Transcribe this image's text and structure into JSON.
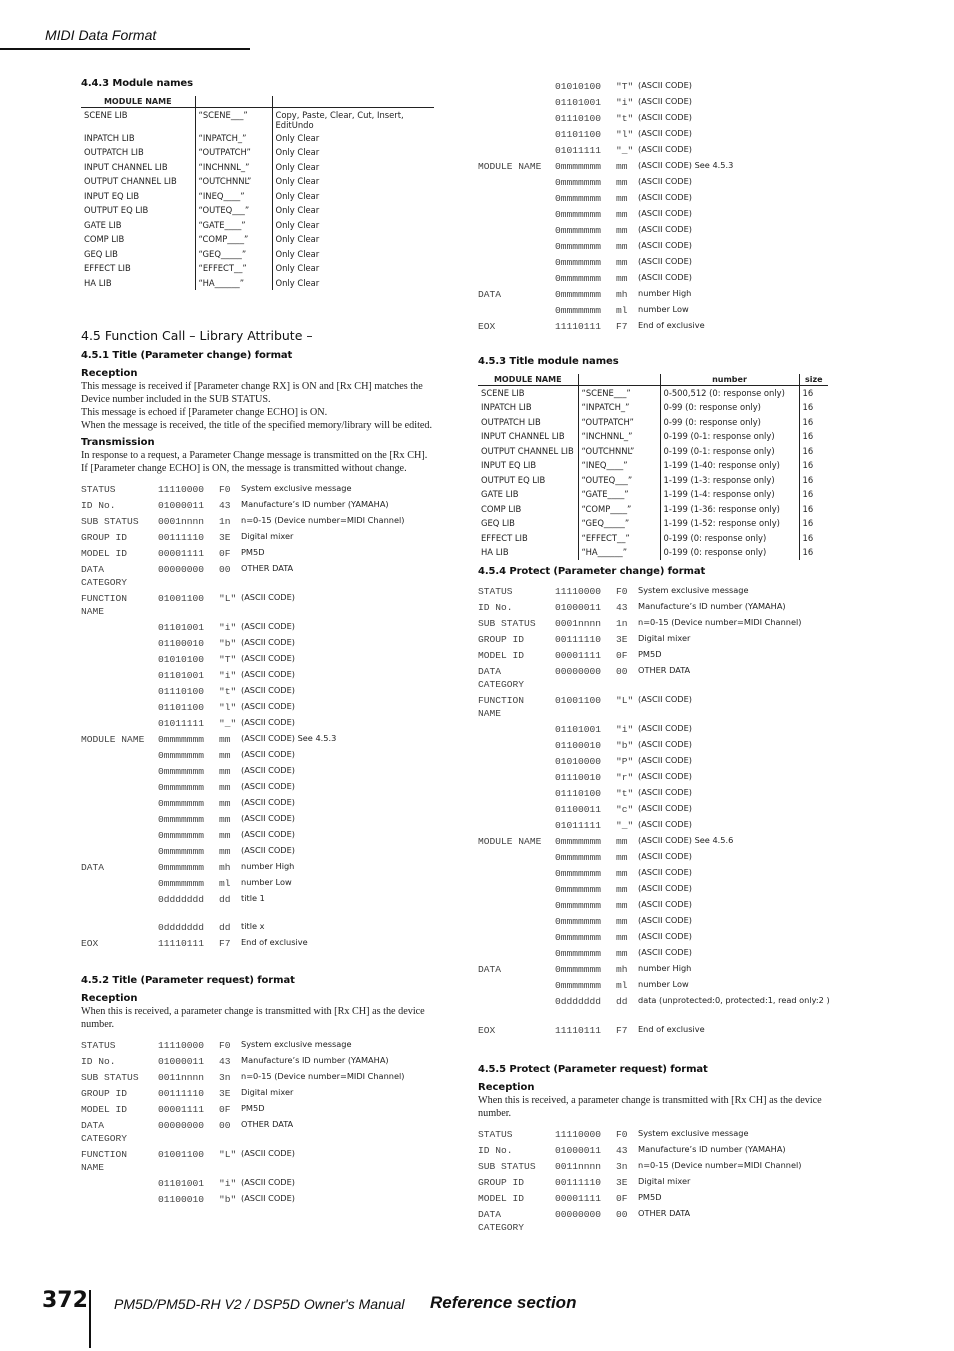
{
  "header": {
    "title": "MIDI Data Format"
  },
  "footer": {
    "page_number": "372",
    "manual_title": "PM5D/PM5D-RH V2 / DSP5D Owner's Manual",
    "section": "Reference section"
  },
  "s443": {
    "heading": "4.4.3 Module names",
    "columns": [
      "MODULE NAME",
      "",
      ""
    ],
    "rows": [
      [
        "SCENE LIB",
        "“SCENE___”",
        "Copy, Paste, Clear, Cut, Insert, EditUndo"
      ],
      [
        "INPATCH LIB",
        "“INPATCH_”",
        "Only Clear"
      ],
      [
        "OUTPATCH LIB",
        "“OUTPATCH”",
        "Only Clear"
      ],
      [
        "INPUT CHANNEL LIB",
        "“INCHNNL_”",
        "Only Clear"
      ],
      [
        "OUTPUT CHANNEL LIB",
        "“OUTCHNNL”",
        "Only Clear"
      ],
      [
        "INPUT EQ LIB",
        "“INEQ____”",
        "Only Clear"
      ],
      [
        "OUTPUT EQ LIB",
        "“OUTEQ___”",
        "Only Clear"
      ],
      [
        "GATE LIB",
        "“GATE____”",
        "Only Clear"
      ],
      [
        "COMP LIB",
        "“COMP____”",
        "Only Clear"
      ],
      [
        "GEQ LIB",
        "“GEQ_____”",
        "Only Clear"
      ],
      [
        "EFFECT LIB",
        "“EFFECT__”",
        "Only Clear"
      ],
      [
        "HA LIB",
        "“HA______”",
        "Only Clear"
      ]
    ]
  },
  "s45": {
    "heading": "4.5  Function Call – Library Attribute –"
  },
  "s451": {
    "heading": "4.5.1 Title (Parameter change) format",
    "reception_heading": "Reception",
    "reception_text": [
      "This message is received if [Parameter change RX] is ON and [Rx CH] matches the Device number included in the SUB STATUS.",
      "This message is echoed if [Parameter change ECHO] is ON.",
      "When the message is received, the title of the specified memory/library will be edited."
    ],
    "transmission_heading": "Transmission",
    "transmission_text": [
      "In response to a request, a Parameter Change message is transmitted on the [Rx CH].",
      "If [Parameter change ECHO] is ON, the message is transmitted without change."
    ],
    "rows": [
      [
        "STATUS",
        "11110000",
        "F0",
        "System exclusive message"
      ],
      [
        "ID No.",
        "01000011",
        "43",
        "Manufacture’s ID number (YAMAHA)"
      ],
      [
        "SUB STATUS",
        "0001nnnn",
        "1n",
        "n=0-15 (Device number=MIDI Channel)"
      ],
      [
        "GROUP ID",
        "00111110",
        "3E",
        "Digital mixer"
      ],
      [
        "MODEL ID",
        "00001111",
        "0F",
        "PM5D"
      ],
      [
        "DATA\nCATEGORY",
        "00000000",
        "00",
        "OTHER DATA"
      ],
      [
        "FUNCTION\nNAME",
        "01001100",
        "\"L\"",
        "(ASCII CODE)"
      ],
      [
        "",
        "01101001",
        "\"i\"",
        "(ASCII CODE)"
      ],
      [
        "",
        "01100010",
        "\"b\"",
        "(ASCII CODE)"
      ],
      [
        "",
        "01010100",
        "\"T\"",
        "(ASCII CODE)"
      ],
      [
        "",
        "01101001",
        "\"i\"",
        "(ASCII CODE)"
      ],
      [
        "",
        "01110100",
        "\"t\"",
        "(ASCII CODE)"
      ],
      [
        "",
        "01101100",
        "\"l\"",
        "(ASCII CODE)"
      ],
      [
        "",
        "01011111",
        "\"_\"",
        "(ASCII CODE)"
      ],
      [
        "MODULE NAME",
        "0mmmmmmm",
        "mm",
        "(ASCII CODE) See 4.5.3"
      ],
      [
        "",
        "0mmmmmmm",
        "mm",
        "(ASCII CODE)"
      ],
      [
        "",
        "0mmmmmmm",
        "mm",
        "(ASCII CODE)"
      ],
      [
        "",
        "0mmmmmmm",
        "mm",
        "(ASCII CODE)"
      ],
      [
        "",
        "0mmmmmmm",
        "mm",
        "(ASCII CODE)"
      ],
      [
        "",
        "0mmmmmmm",
        "mm",
        "(ASCII CODE)"
      ],
      [
        "",
        "0mmmmmmm",
        "mm",
        "(ASCII CODE)"
      ],
      [
        "",
        "0mmmmmmm",
        "mm",
        "(ASCII CODE)"
      ],
      [
        "DATA",
        "0mmmmmmm",
        "mh",
        "number High"
      ],
      [
        "",
        "0mmmmmmm",
        "ml",
        "number Low"
      ],
      [
        "",
        "0ddddddd",
        "dd",
        "title 1"
      ],
      [
        "",
        "0ddddddd",
        "dd",
        "title x"
      ],
      [
        "EOX",
        "11110111",
        "F7",
        "End of exclusive"
      ]
    ]
  },
  "s452": {
    "heading": "4.5.2 Title (Parameter request) format",
    "reception_heading": "Reception",
    "reception_text": "When this is received, a parameter change is transmitted with [Rx CH] as the device number.",
    "rows_left": [
      [
        "STATUS",
        "11110000",
        "F0",
        "System exclusive message"
      ],
      [
        "ID No.",
        "01000011",
        "43",
        "Manufacture’s ID number (YAMAHA)"
      ],
      [
        "SUB STATUS",
        "0011nnnn",
        "3n",
        "n=0-15 (Device number=MIDI Channel)"
      ],
      [
        "GROUP ID",
        "00111110",
        "3E",
        "Digital mixer"
      ],
      [
        "MODEL ID",
        "00001111",
        "0F",
        "PM5D"
      ],
      [
        "DATA\nCATEGORY",
        "00000000",
        "00",
        "OTHER DATA"
      ],
      [
        "FUNCTION\nNAME",
        "01001100",
        "\"L\"",
        "(ASCII CODE)"
      ],
      [
        "",
        "01101001",
        "\"i\"",
        "(ASCII CODE)"
      ],
      [
        "",
        "01100010",
        "\"b\"",
        "(ASCII CODE)"
      ]
    ],
    "rows_right": [
      [
        "",
        "01010100",
        "\"T\"",
        "(ASCII CODE)"
      ],
      [
        "",
        "01101001",
        "\"i\"",
        "(ASCII CODE)"
      ],
      [
        "",
        "01110100",
        "\"t\"",
        "(ASCII CODE)"
      ],
      [
        "",
        "01101100",
        "\"l\"",
        "(ASCII CODE)"
      ],
      [
        "",
        "01011111",
        "\"_\"",
        "(ASCII CODE)"
      ],
      [
        "MODULE NAME",
        "0mmmmmmm",
        "mm",
        "(ASCII CODE) See 4.5.3"
      ],
      [
        "",
        "0mmmmmmm",
        "mm",
        "(ASCII CODE)"
      ],
      [
        "",
        "0mmmmmmm",
        "mm",
        "(ASCII CODE)"
      ],
      [
        "",
        "0mmmmmmm",
        "mm",
        "(ASCII CODE)"
      ],
      [
        "",
        "0mmmmmmm",
        "mm",
        "(ASCII CODE)"
      ],
      [
        "",
        "0mmmmmmm",
        "mm",
        "(ASCII CODE)"
      ],
      [
        "",
        "0mmmmmmm",
        "mm",
        "(ASCII CODE)"
      ],
      [
        "",
        "0mmmmmmm",
        "mm",
        "(ASCII CODE)"
      ],
      [
        "DATA",
        "0mmmmmmm",
        "mh",
        "number High"
      ],
      [
        "",
        "0mmmmmmm",
        "ml",
        "number Low"
      ],
      [
        "EOX",
        "11110111",
        "F7",
        "End of exclusive"
      ]
    ]
  },
  "s453": {
    "heading": "4.5.3 Title module names",
    "columns": [
      "MODULE NAME",
      "",
      "number",
      "size"
    ],
    "rows": [
      [
        "SCENE LIB",
        "“SCENE___”",
        "0-500,512 (0: response only)",
        "16"
      ],
      [
        "INPATCH LIB",
        "“INPATCH_”",
        "0-99 (0: response only)",
        "16"
      ],
      [
        "OUTPATCH LIB",
        "“OUTPATCH”",
        "0-99 (0: response only)",
        "16"
      ],
      [
        "INPUT CHANNEL LIB",
        "“INCHNNL_”",
        "0-199 (0-1: response only)",
        "16"
      ],
      [
        "OUTPUT CHANNEL LIB",
        "“OUTCHNNL”",
        "0-199 (0-1: response only)",
        "16"
      ],
      [
        "INPUT EQ LIB",
        "“INEQ____”",
        "1-199 (1-40: response only)",
        "16"
      ],
      [
        "OUTPUT EQ LIB",
        "“OUTEQ___”",
        "1-199 (1-3: response only)",
        "16"
      ],
      [
        "GATE LIB",
        "“GATE____”",
        "1-199 (1-4: response only)",
        "16"
      ],
      [
        "COMP LIB",
        "“COMP____”",
        "1-199 (1-36: response only)",
        "16"
      ],
      [
        "GEQ LIB",
        "“GEQ_____”",
        "1-199 (1-52: response only)",
        "16"
      ],
      [
        "EFFECT LIB",
        "“EFFECT__”",
        "0-199 (0: response only)",
        "16"
      ],
      [
        "HA LIB",
        "“HA______”",
        "0-199 (0: response only)",
        "16"
      ]
    ]
  },
  "s454": {
    "heading": "4.5.4 Protect (Parameter change) format",
    "rows": [
      [
        "STATUS",
        "11110000",
        "F0",
        "System exclusive message"
      ],
      [
        "ID No.",
        "01000011",
        "43",
        "Manufacture’s ID number (YAMAHA)"
      ],
      [
        "SUB STATUS",
        "0001nnnn",
        "1n",
        "n=0-15 (Device number=MIDI Channel)"
      ],
      [
        "GROUP ID",
        "00111110",
        "3E",
        "Digital mixer"
      ],
      [
        "MODEL ID",
        "00001111",
        "0F",
        "PM5D"
      ],
      [
        "DATA\nCATEGORY",
        "00000000",
        "00",
        "OTHER DATA"
      ],
      [
        "FUNCTION\nNAME",
        "01001100",
        "\"L\"",
        "(ASCII CODE)"
      ],
      [
        "",
        "01101001",
        "\"i\"",
        "(ASCII CODE)"
      ],
      [
        "",
        "01100010",
        "\"b\"",
        "(ASCII CODE)"
      ],
      [
        "",
        "01010000",
        "\"P\"",
        "(ASCII CODE)"
      ],
      [
        "",
        "01110010",
        "\"r\"",
        "(ASCII CODE)"
      ],
      [
        "",
        "01110100",
        "\"t\"",
        "(ASCII CODE)"
      ],
      [
        "",
        "01100011",
        "\"c\"",
        "(ASCII CODE)"
      ],
      [
        "",
        "01011111",
        "\"_\"",
        "(ASCII CODE)"
      ],
      [
        "MODULE NAME",
        "0mmmmmmm",
        "mm",
        "(ASCII CODE) See 4.5.6"
      ],
      [
        "",
        "0mmmmmmm",
        "mm",
        "(ASCII CODE)"
      ],
      [
        "",
        "0mmmmmmm",
        "mm",
        "(ASCII CODE)"
      ],
      [
        "",
        "0mmmmmmm",
        "mm",
        "(ASCII CODE)"
      ],
      [
        "",
        "0mmmmmmm",
        "mm",
        "(ASCII CODE)"
      ],
      [
        "",
        "0mmmmmmm",
        "mm",
        "(ASCII CODE)"
      ],
      [
        "",
        "0mmmmmmm",
        "mm",
        "(ASCII CODE)"
      ],
      [
        "",
        "0mmmmmmm",
        "mm",
        "(ASCII CODE)"
      ],
      [
        "DATA",
        "0mmmmmmm",
        "mh",
        "number High"
      ],
      [
        "",
        "0mmmmmmm",
        "ml",
        "number Low"
      ],
      [
        "",
        "0ddddddd",
        "dd",
        "data (unprotected:0, protected:1, read only:2 )"
      ],
      [
        "EOX",
        "11110111",
        "F7",
        "End of exclusive"
      ]
    ]
  },
  "s455": {
    "heading": "4.5.5 Protect (Parameter request) format",
    "reception_heading": "Reception",
    "reception_text": "When this is received, a parameter change is transmitted with [Rx CH] as the device number.",
    "rows": [
      [
        "STATUS",
        "11110000",
        "F0",
        "System exclusive message"
      ],
      [
        "ID No.",
        "01000011",
        "43",
        "Manufacture’s ID number (YAMAHA)"
      ],
      [
        "SUB STATUS",
        "0011nnnn",
        "3n",
        "n=0-15 (Device number=MIDI Channel)"
      ],
      [
        "GROUP ID",
        "00111110",
        "3E",
        "Digital mixer"
      ],
      [
        "MODEL ID",
        "00001111",
        "0F",
        "PM5D"
      ],
      [
        "DATA\nCATEGORY",
        "00000000",
        "00",
        "OTHER DATA"
      ]
    ]
  }
}
